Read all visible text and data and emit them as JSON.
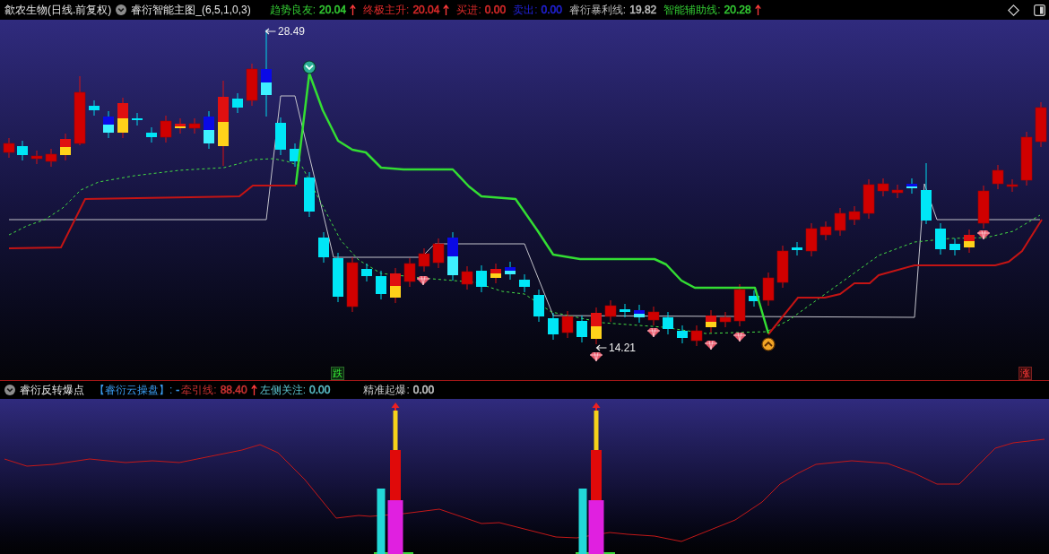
{
  "header": {
    "title": "歙农生物(日线.前复权)",
    "indicator": "睿衍智能主图_(6,5,1,0,3)",
    "readings": [
      {
        "label": "趋势良友:",
        "value": "20.04",
        "rising": true,
        "color": "#33cc33"
      },
      {
        "label": "终极主升:",
        "value": "20.04",
        "rising": true,
        "color": "#dd2a2a"
      },
      {
        "label": "买进:",
        "value": "0.00",
        "rising": false,
        "color": "#dd2a2a"
      },
      {
        "label": "卖出:",
        "value": "0.00",
        "rising": false,
        "color": "#2222dd"
      },
      {
        "label": "睿衍暴利线:",
        "value": "19.82",
        "rising": false,
        "color": "#bbbbbb"
      },
      {
        "label": "智能辅助线:",
        "value": "20.28",
        "rising": true,
        "color": "#33cc33"
      }
    ]
  },
  "main_chart": {
    "price_labels": [
      {
        "kind": "high",
        "text": "28.49"
      },
      {
        "kind": "low",
        "text": "14.21"
      }
    ],
    "signal_tags": [
      {
        "kind": "fall",
        "text": "跌"
      },
      {
        "kind": "rise",
        "text": "涨"
      }
    ]
  },
  "sub_header": {
    "indicator": "睿衍反转爆点",
    "readings": [
      {
        "label": "【睿衍云操盘】:",
        "value": "-",
        "rising": false,
        "color": "#3a9cf0"
      },
      {
        "label": "牵引线:",
        "value": "88.40",
        "rising": true,
        "color": "#cd3232"
      },
      {
        "label": "左侧关注:",
        "value": "0.00",
        "rising": false,
        "color": "#5abec8"
      },
      {
        "label": "精准起爆:",
        "value": "0.00",
        "rising": false,
        "color": "#c8c8c8"
      }
    ]
  }
}
